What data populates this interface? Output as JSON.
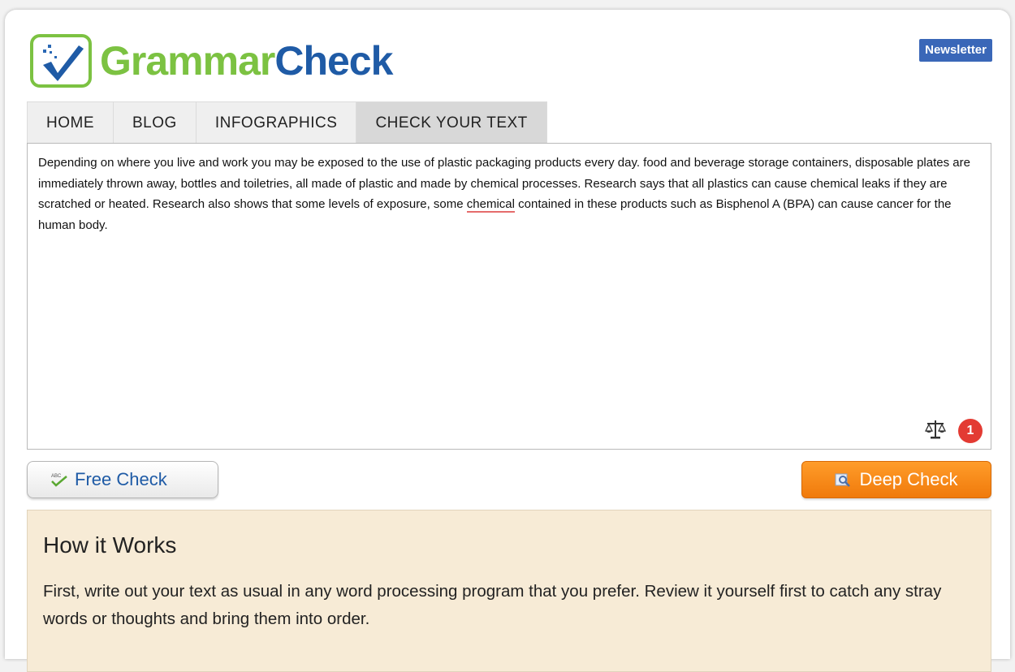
{
  "brand": {
    "name_part1": "Grammar",
    "name_part2": "Check",
    "green": "#7cc242",
    "blue": "#1f5ba6",
    "logo_icon": "checkmark-icon"
  },
  "header": {
    "newsletter_label": "Newsletter"
  },
  "nav": {
    "tabs": [
      {
        "label": "HOME",
        "active": false
      },
      {
        "label": "BLOG",
        "active": false
      },
      {
        "label": "INFOGRAPHICS",
        "active": false
      },
      {
        "label": "CHECK YOUR TEXT",
        "active": true
      }
    ]
  },
  "editor": {
    "text_before": "Depending on where you live and work you may be exposed to the use of plastic packaging products every day. food and beverage storage containers, disposable plates are immediately thrown away, bottles and toiletries, all made of plastic and made by chemical processes. Research says that all plastics can cause chemical leaks if they are scratched or heated. Research also shows that some levels of exposure, some ",
    "flagged_word": "chemical",
    "text_after": " contained in these products such as Bisphenol A (BPA) can cause cancer for the human body.",
    "error_count": "1",
    "scale_icon": "balance-scale-icon"
  },
  "actions": {
    "free_check_label": "Free Check",
    "deep_check_label": "Deep Check",
    "deep_color": "#f28a15"
  },
  "how_it_works": {
    "title": "How it Works",
    "body": "First, write out your text as usual in any word processing program that you prefer. Review it yourself first to catch any stray words or thoughts and bring them into order."
  }
}
